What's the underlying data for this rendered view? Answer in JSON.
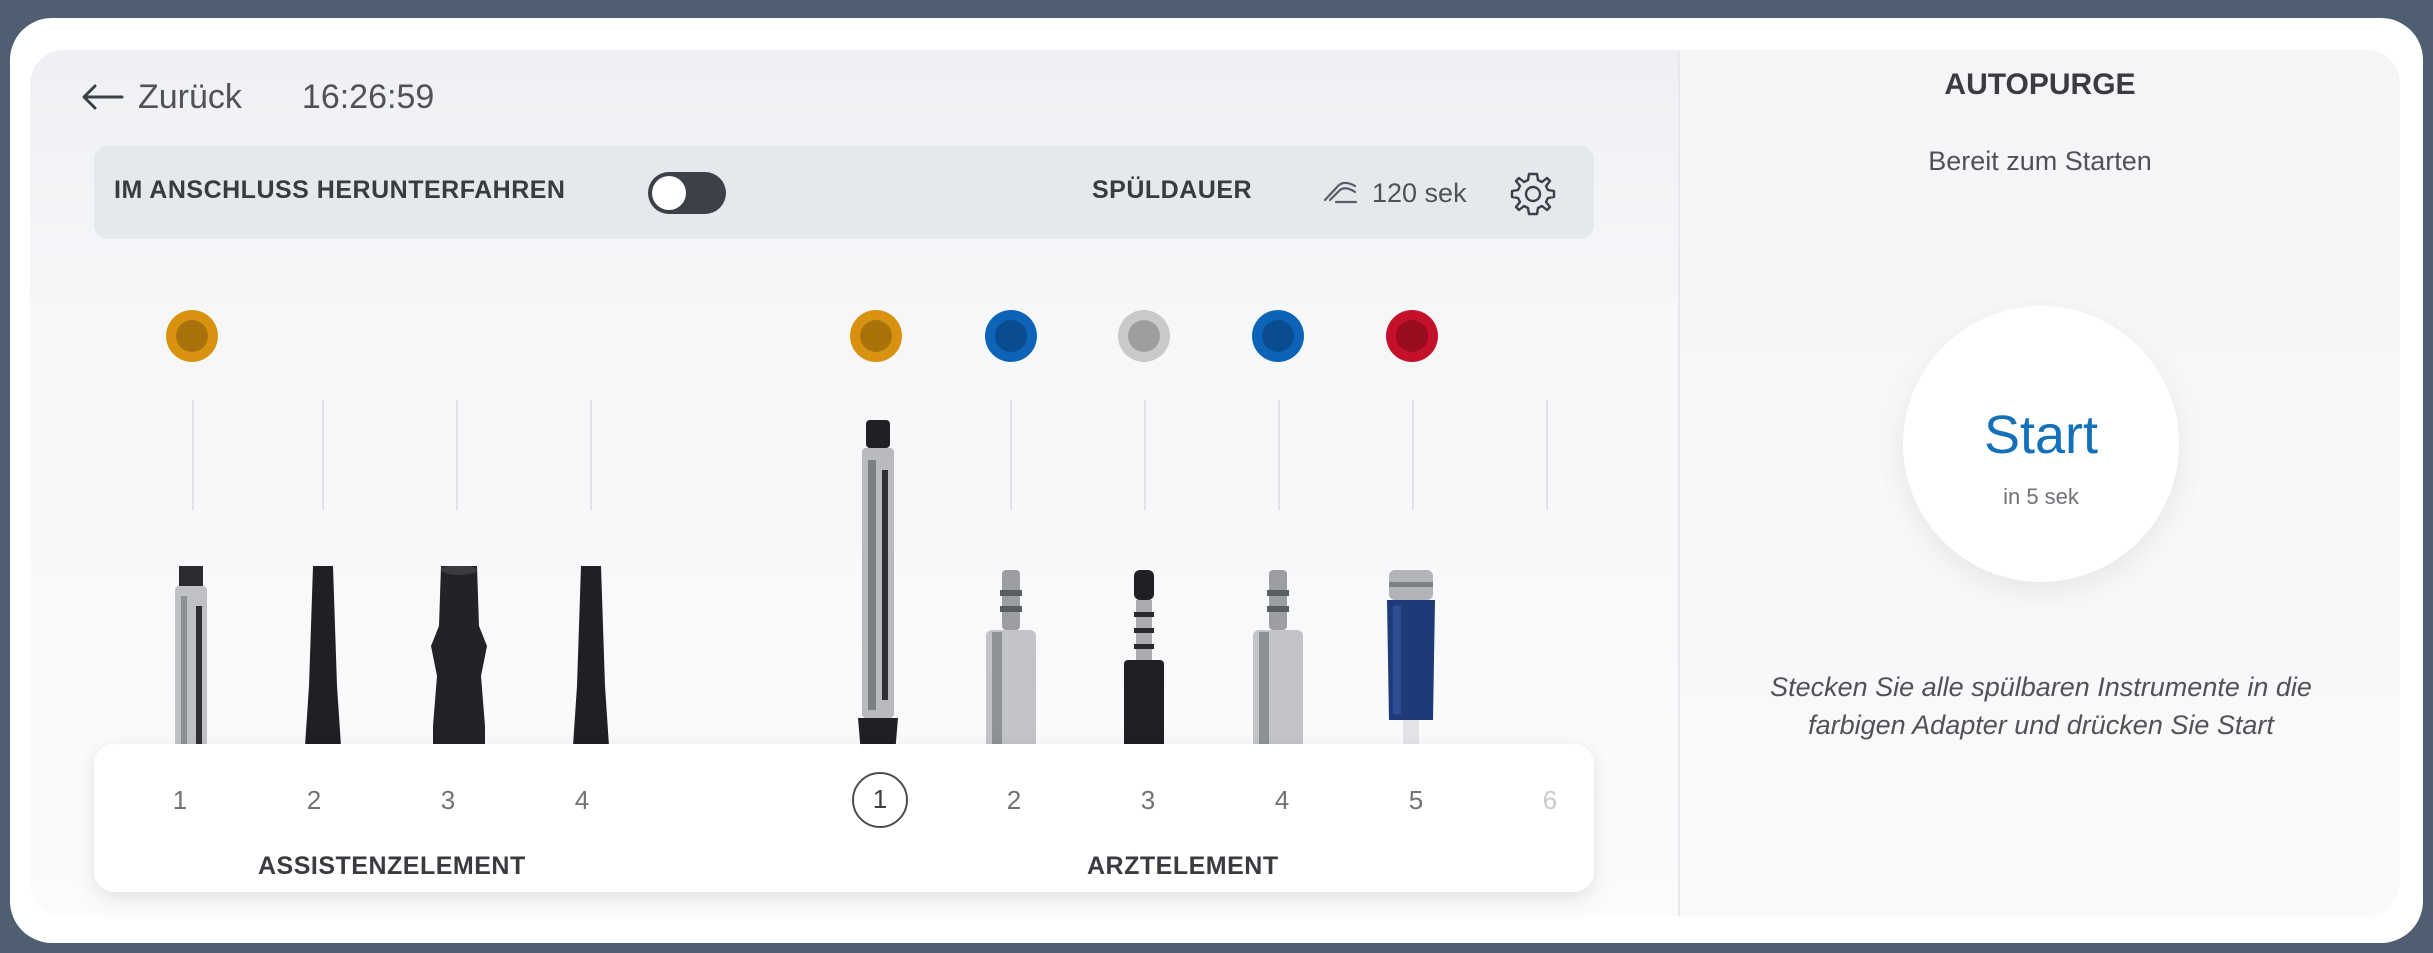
{
  "header": {
    "back_label": "Zurück",
    "time": "16:26:59"
  },
  "options": {
    "shutdown_label": "IM ANSCHLUSS HERUNTERFAHREN",
    "shutdown_enabled": false,
    "rinse_label": "SPÜLDAUER",
    "rinse_duration": "120 sek"
  },
  "assistant_element": {
    "label": "ASSISTENZELEMENT",
    "ports": [
      {
        "number": "1",
        "cap_color": "#d9920f",
        "instrument": "handpiece-tip-icon"
      },
      {
        "number": "2",
        "cap_color": null,
        "instrument": "cone-tip-icon"
      },
      {
        "number": "3",
        "cap_color": null,
        "instrument": "suction-tip-icon"
      },
      {
        "number": "4",
        "cap_color": null,
        "instrument": "cone-tip-icon"
      }
    ]
  },
  "doctor_element": {
    "label": "ARZTELEMENT",
    "ports": [
      {
        "number": "1",
        "cap_color": "#d9920f",
        "selected": true,
        "instrument": "syringe-icon"
      },
      {
        "number": "2",
        "cap_color": "#0d63b8",
        "instrument": "motor-coupling-icon"
      },
      {
        "number": "3",
        "cap_color": "#c8c9cb",
        "instrument": "turbine-coupling-icon"
      },
      {
        "number": "4",
        "cap_color": "#0d63b8",
        "instrument": "motor-coupling-icon"
      },
      {
        "number": "5",
        "cap_color": "#c4102a",
        "instrument": "blue-coupling-icon"
      },
      {
        "number": "6",
        "cap_color": null,
        "disabled": true,
        "instrument": null
      }
    ]
  },
  "autopurge": {
    "title": "AUTOPURGE",
    "status": "Bereit zum Starten",
    "start_label": "Start",
    "start_sub": "in 5 sek",
    "hint": "Stecken Sie alle spülbaren Instrumente in die farbigen Adapter und drücken Sie Start"
  },
  "colors": {
    "accent": "#1470b8",
    "toggle_off": "#3d4046"
  }
}
